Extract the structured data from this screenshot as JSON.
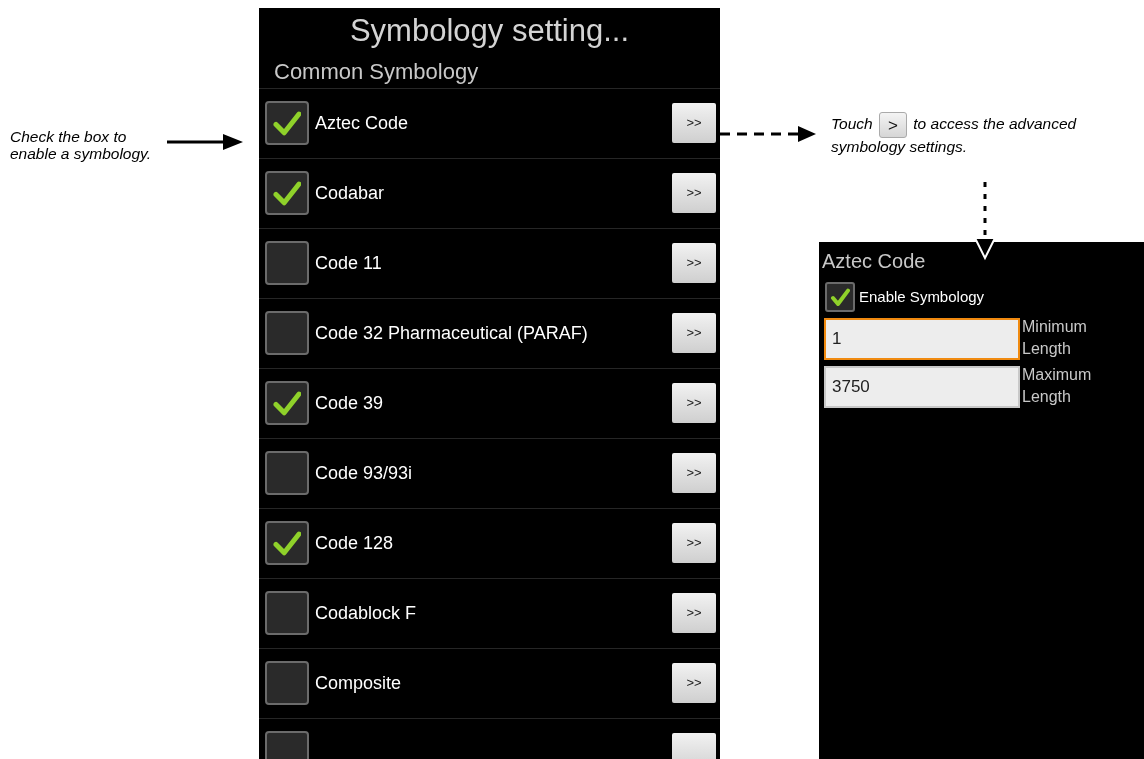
{
  "left_note": {
    "text": "Check the box to enable a symbology."
  },
  "right_note": {
    "before": "Touch",
    "button": ">",
    "after": "to access the advanced symbology settings."
  },
  "main_screen": {
    "title": "Symbology setting...",
    "section": "Common Symbology",
    "rows": [
      {
        "label": "Aztec Code",
        "checked": true,
        "button": ">>"
      },
      {
        "label": "Codabar",
        "checked": true,
        "button": ">>"
      },
      {
        "label": "Code 11",
        "checked": false,
        "button": ">>"
      },
      {
        "label": "Code 32 Pharmaceutical (PARAF)",
        "checked": false,
        "button": ">>"
      },
      {
        "label": "Code 39",
        "checked": true,
        "button": ">>"
      },
      {
        "label": "Code 93/93i",
        "checked": false,
        "button": ">>"
      },
      {
        "label": "Code 128",
        "checked": true,
        "button": ">>"
      },
      {
        "label": "Codablock F",
        "checked": false,
        "button": ">>"
      },
      {
        "label": "Composite",
        "checked": false,
        "button": ">>"
      },
      {
        "checked": false
      }
    ]
  },
  "detail_screen": {
    "title": "Aztec Code",
    "enable": {
      "label": "Enable Symbology",
      "checked": true
    },
    "fields": [
      {
        "value": "1",
        "label": "Minimum Length",
        "focused": true
      },
      {
        "value": "3750",
        "label": "Maximum Length",
        "focused": false
      }
    ]
  }
}
